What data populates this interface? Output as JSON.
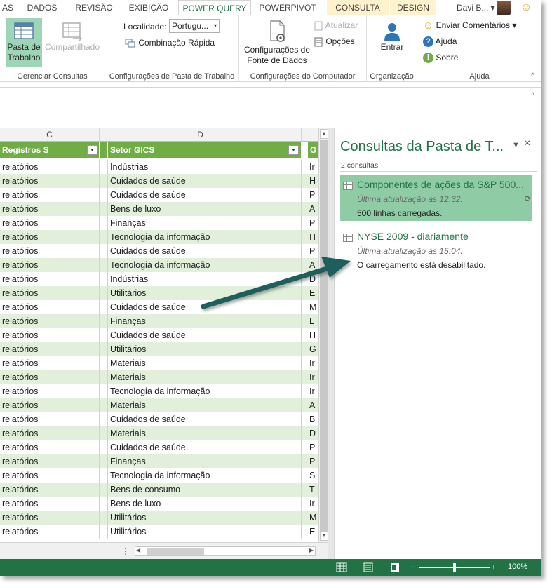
{
  "tabs": [
    {
      "label": "AS"
    },
    {
      "label": "DADOS"
    },
    {
      "label": "REVISÃO"
    },
    {
      "label": "EXIBIÇÃO"
    },
    {
      "label": "POWER QUERY"
    },
    {
      "label": "POWERPIVOT"
    },
    {
      "label": "CONSULTA"
    },
    {
      "label": "DESIGN"
    }
  ],
  "user": {
    "name": "Davi B... ▾"
  },
  "ribbon": {
    "manage": {
      "pasta": "Pasta de Trabalho",
      "compartilhado": "Compartilhado",
      "label": "Gerenciar Consultas"
    },
    "workbook": {
      "localidade_label": "Localidade:",
      "localidade_value": "Portugu...",
      "combinacao": "Combinação Rápida",
      "label": "Configurações de Pasta de Trabalho"
    },
    "computer": {
      "config": "Configurações de Fonte de Dados",
      "atualizar": "Atualizar",
      "opcoes": "Opções",
      "label": "Configurações do Computador"
    },
    "org": {
      "entrar": "Entrar",
      "label": "Organização"
    },
    "help": {
      "enviar": "Enviar Comentários ▾",
      "ajuda": "Ajuda",
      "sobre": "Sobre",
      "label": "Ajuda"
    }
  },
  "grid": {
    "col_letters": [
      "C",
      "D"
    ],
    "headers": [
      "Registros S",
      "Setor GICS",
      "G"
    ],
    "rows": [
      [
        "relatórios",
        "Indústrias",
        "Ir"
      ],
      [
        "relatórios",
        "Cuidados de saúde",
        "H"
      ],
      [
        "relatórios",
        "Cuidados de saúde",
        "P"
      ],
      [
        "relatórios",
        "Bens de luxo",
        "A"
      ],
      [
        "relatórios",
        "Finanças",
        "P"
      ],
      [
        "relatórios",
        "Tecnologia da informação",
        "IT"
      ],
      [
        "relatórios",
        "Cuidados de saúde",
        "P"
      ],
      [
        "relatórios",
        "Tecnologia da informação",
        "A"
      ],
      [
        "relatórios",
        "Indústrias",
        "D"
      ],
      [
        "relatórios",
        "Utilitários",
        "E"
      ],
      [
        "relatórios",
        "Cuidados de saúde",
        "M"
      ],
      [
        "relatórios",
        "Finanças",
        "L"
      ],
      [
        "relatórios",
        "Cuidados de saúde",
        "H"
      ],
      [
        "relatórios",
        "Utilitários",
        "G"
      ],
      [
        "relatórios",
        "Materiais",
        "Ir"
      ],
      [
        "relatórios",
        "Materiais",
        "Ir"
      ],
      [
        "relatórios",
        "Tecnologia da informação",
        "Ir"
      ],
      [
        "relatórios",
        "Materiais",
        "A"
      ],
      [
        "relatórios",
        "Cuidados de saúde",
        "B"
      ],
      [
        "relatórios",
        "Materiais",
        "D"
      ],
      [
        "relatórios",
        "Cuidados de saúde",
        "P"
      ],
      [
        "relatórios",
        "Finanças",
        "P"
      ],
      [
        "relatórios",
        "Tecnologia da informação",
        "S"
      ],
      [
        "relatórios",
        "Bens de consumo",
        "T"
      ],
      [
        "relatórios",
        "Bens de luxo",
        "Ir"
      ],
      [
        "relatórios",
        "Utilitários",
        "M"
      ],
      [
        "relatórios",
        "Utilitários",
        "E"
      ]
    ]
  },
  "pane": {
    "title": "Consultas da Pasta de T...",
    "count": "2 consultas",
    "queries": [
      {
        "name": "Componentes de ações da S&P 500...",
        "time": "Última atualização às 12:32.",
        "status": "500 linhas carregadas."
      },
      {
        "name": "NYSE 2009 - diariamente",
        "time": "Última atualização às 15:04.",
        "status": "O carregamento está desabilitado."
      }
    ]
  },
  "statusbar": {
    "zoom": "100%"
  },
  "colors": {
    "accent": "#217346",
    "table_header": "#70ad47",
    "row_alt": "#e2efda",
    "selected_query": "#8fcca6",
    "arrow": "#1f5f5b"
  }
}
